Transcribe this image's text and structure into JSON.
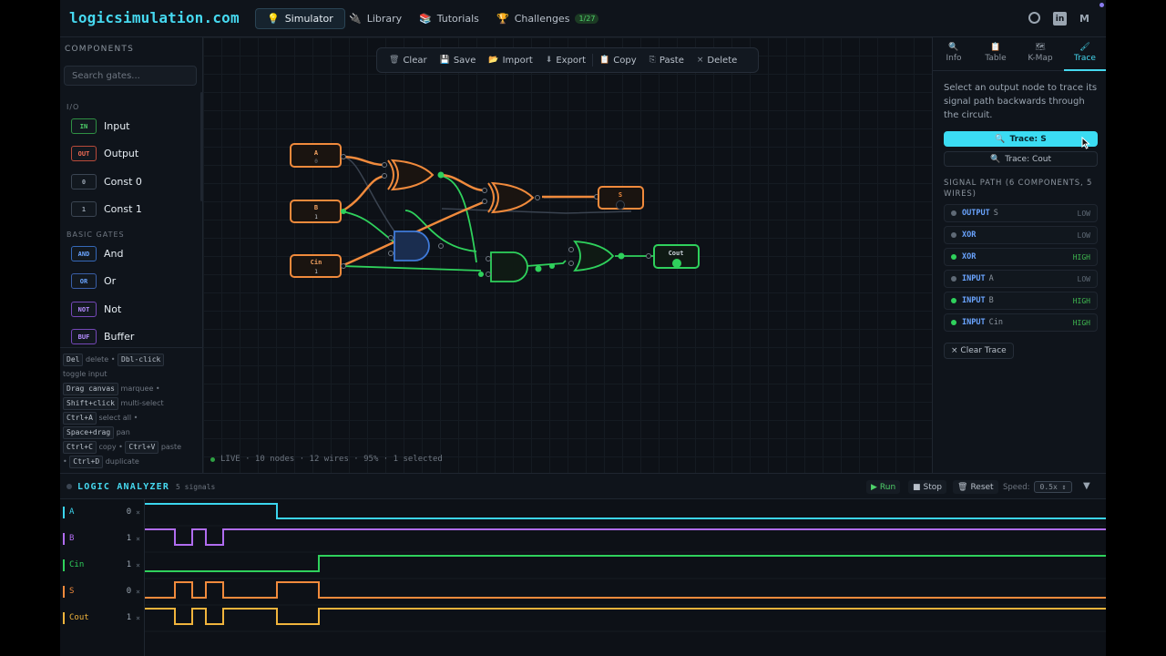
{
  "app": {
    "title": "logicsimulation.com"
  },
  "nav": [
    {
      "icon": "💡",
      "label": "Simulator"
    },
    {
      "icon": "🔌",
      "label": "Library"
    },
    {
      "icon": "📚",
      "label": "Tutorials"
    },
    {
      "icon": "🏆",
      "label": "Challenges",
      "badge": "1/27"
    }
  ],
  "top_icons": [
    "github-icon",
    "linkedin-icon",
    "medium-icon"
  ],
  "sidebar": {
    "title": "COMPONENTS",
    "search_placeholder": "Search gates...",
    "io_title": "I/O",
    "io": [
      {
        "chip": "IN",
        "label": "Input"
      },
      {
        "chip": "OUT",
        "label": "Output"
      },
      {
        "chip": "0",
        "label": "Const 0"
      },
      {
        "chip": "1",
        "label": "Const 1"
      }
    ],
    "basic_title": "BASIC GATES",
    "basic": [
      {
        "chip": "AND",
        "label": "And"
      },
      {
        "chip": "OR",
        "label": "Or"
      },
      {
        "chip": "NOT",
        "label": "Not"
      },
      {
        "chip": "BUF",
        "label": "Buffer"
      }
    ]
  },
  "shortcuts": {
    "del": "Del",
    "del_t": "delete",
    "dbl": "Dbl-click",
    "dbl_t": "toggle input",
    "drag": "Drag canvas",
    "drag_t": "marquee",
    "shift": "Shift+click",
    "shift_t": "multi-select",
    "ctrla": "Ctrl+A",
    "ctrla_t": "select all",
    "space": "Space+drag",
    "space_t": "pan",
    "ctrlc": "Ctrl+C",
    "ctrlc_t": "copy",
    "ctrlv": "Ctrl+V",
    "ctrlv_t": "paste",
    "ctrld": "Ctrl+D",
    "ctrld_t": "duplicate"
  },
  "toolbar": {
    "clear": "Clear",
    "save": "Save",
    "import": "Import",
    "export": "Export",
    "copy": "Copy",
    "paste": "Paste",
    "delete": "Delete"
  },
  "status": "LIVE · 10 nodes · 12 wires · 95% · 1 selected",
  "circuit": {
    "input_a": {
      "name": "A",
      "value": "0"
    },
    "input_b": {
      "name": "B",
      "value": "1"
    },
    "input_cin": {
      "name": "Cin",
      "value": "1"
    },
    "output_s": {
      "name": "S"
    },
    "output_cout": {
      "name": "Cout"
    }
  },
  "right_panel": {
    "tabs": [
      {
        "icon": "🔍",
        "label": "Info"
      },
      {
        "icon": "📋",
        "label": "Table"
      },
      {
        "icon": "🗺",
        "label": "K-Map"
      },
      {
        "icon": "🖌",
        "label": "Trace"
      }
    ],
    "help": "Select an output node to trace its signal path backwards through the circuit.",
    "trace_s": "Trace: S",
    "trace_cout": "Trace: Cout",
    "path_title": "SIGNAL PATH (6 COMPONENTS, 5 WIRES)",
    "path": [
      {
        "kind": "OUTPUT",
        "name": "S",
        "level": "LOW"
      },
      {
        "kind": "XOR",
        "name": "",
        "level": "LOW"
      },
      {
        "kind": "XOR",
        "name": "",
        "level": "HIGH"
      },
      {
        "kind": "INPUT",
        "name": "A",
        "level": "LOW"
      },
      {
        "kind": "INPUT",
        "name": "B",
        "level": "HIGH"
      },
      {
        "kind": "INPUT",
        "name": "Cin",
        "level": "HIGH"
      }
    ],
    "clear_trace": "Clear Trace"
  },
  "analyzer": {
    "title": "LOGIC ANALYZER",
    "count": "5 signals",
    "run": "Run",
    "stop": "Stop",
    "reset": "Reset",
    "speed_label": "Speed:",
    "speed": "0.5x",
    "signals": [
      {
        "name": "A",
        "value": "0",
        "color": "#3bd5ee"
      },
      {
        "name": "B",
        "value": "1",
        "color": "#b06cf0"
      },
      {
        "name": "Cin",
        "value": "1",
        "color": "#2fd15c"
      },
      {
        "name": "S",
        "value": "0",
        "color": "#f08a3c"
      },
      {
        "name": "Cout",
        "value": "1",
        "color": "#f0b43c"
      }
    ]
  },
  "colors": {
    "accent": "#46d9f0",
    "wire_high": "#2fd15c",
    "wire_selected": "#f08a3c",
    "node_border": "#f08a3c",
    "low": "#5f6a76",
    "high": "#3fb950"
  }
}
